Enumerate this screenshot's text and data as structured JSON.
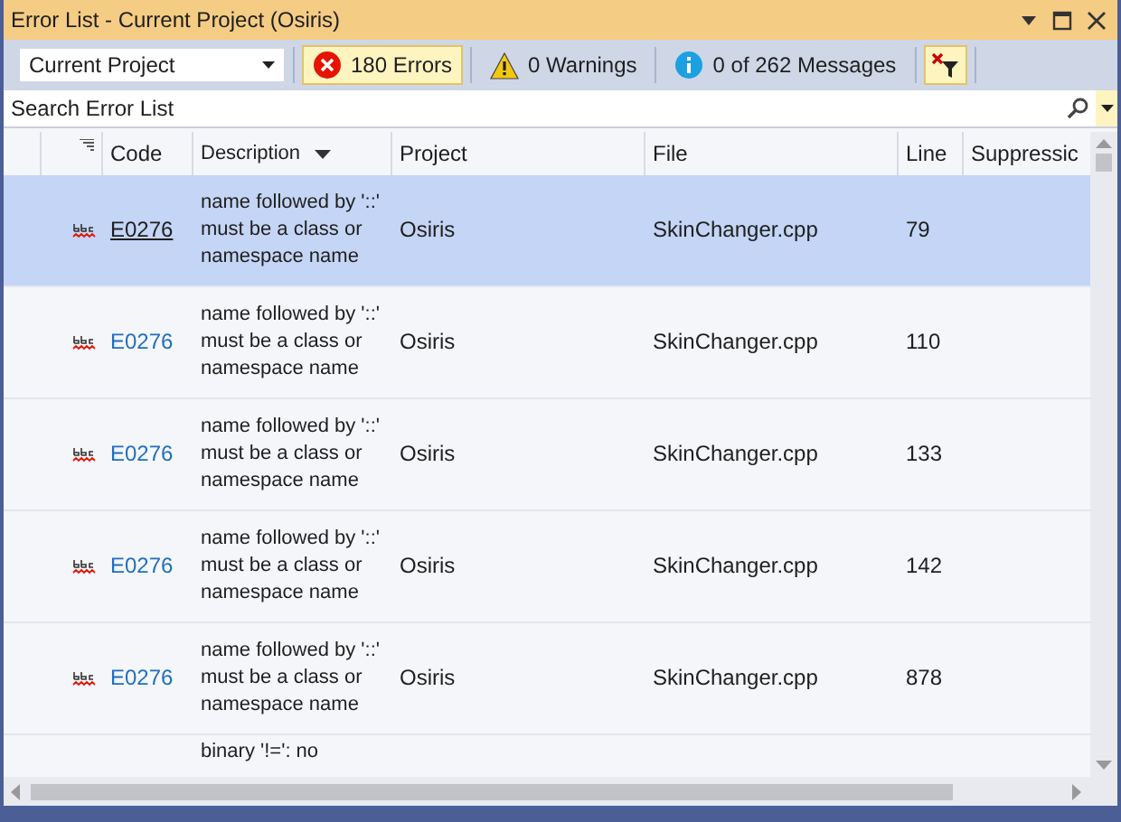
{
  "window": {
    "title": "Error List - Current Project (Osiris)"
  },
  "toolbar": {
    "scope": "Current Project",
    "filters": [
      {
        "kind": "error",
        "label": "180 Errors",
        "selected": true
      },
      {
        "kind": "warning",
        "label": "0 Warnings",
        "selected": false
      },
      {
        "kind": "info",
        "label": "0 of 262 Messages",
        "selected": false
      }
    ]
  },
  "search": {
    "placeholder": "Search Error List"
  },
  "table": {
    "columns": [
      "Code",
      "Description",
      "Project",
      "File",
      "Line",
      "Suppressic"
    ],
    "rows": [
      {
        "code": "E0276",
        "description": "name followed by '::' must be a class or namespace name",
        "project": "Osiris",
        "file": "SkinChanger.cpp",
        "line": "79",
        "selected": true
      },
      {
        "code": "E0276",
        "description": "name followed by '::' must be a class or namespace name",
        "project": "Osiris",
        "file": "SkinChanger.cpp",
        "line": "110",
        "selected": false
      },
      {
        "code": "E0276",
        "description": "name followed by '::' must be a class or namespace name",
        "project": "Osiris",
        "file": "SkinChanger.cpp",
        "line": "133",
        "selected": false
      },
      {
        "code": "E0276",
        "description": "name followed by '::' must be a class or namespace name",
        "project": "Osiris",
        "file": "SkinChanger.cpp",
        "line": "142",
        "selected": false
      },
      {
        "code": "E0276",
        "description": "name followed by '::' must be a class or namespace name",
        "project": "Osiris",
        "file": "SkinChanger.cpp",
        "line": "878",
        "selected": false
      }
    ],
    "partial_row": {
      "description": "binary '!=': no"
    }
  }
}
